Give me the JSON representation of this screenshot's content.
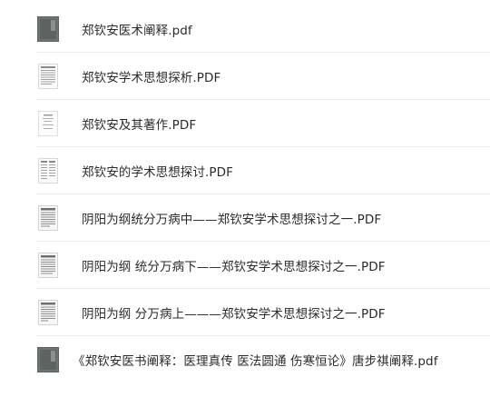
{
  "files": [
    {
      "name": "郑钦安医术阐释.pdf",
      "icon": "book-cover-thumbnail"
    },
    {
      "name": "郑钦安学术思想探析.PDF",
      "icon": "text-page-thumbnail"
    },
    {
      "name": "郑钦安及其著作.PDF",
      "icon": "text-page-thumbnail"
    },
    {
      "name": "郑钦安的学术思想探讨.PDF",
      "icon": "text-page-thumbnail"
    },
    {
      "name": "阴阳为纲统分万病中——郑钦安学术思想探讨之一.PDF",
      "icon": "text-page-thumbnail"
    },
    {
      "name": "阴阳为纲 统分万病下——郑钦安学术思想探讨之一.PDF",
      "icon": "text-page-thumbnail"
    },
    {
      "name": "阴阳为纲 分万病上———郑钦安学术思想探讨之一.PDF",
      "icon": "text-page-thumbnail"
    },
    {
      "name": "《郑钦安医书阐释：医理真传 医法圆通 伤寒恒论》唐步祺阐释.pdf",
      "icon": "book-cover-thumbnail"
    }
  ],
  "colors": {
    "text": "#2b2b2b",
    "divider": "#ededed",
    "cover": "#5d6360"
  }
}
